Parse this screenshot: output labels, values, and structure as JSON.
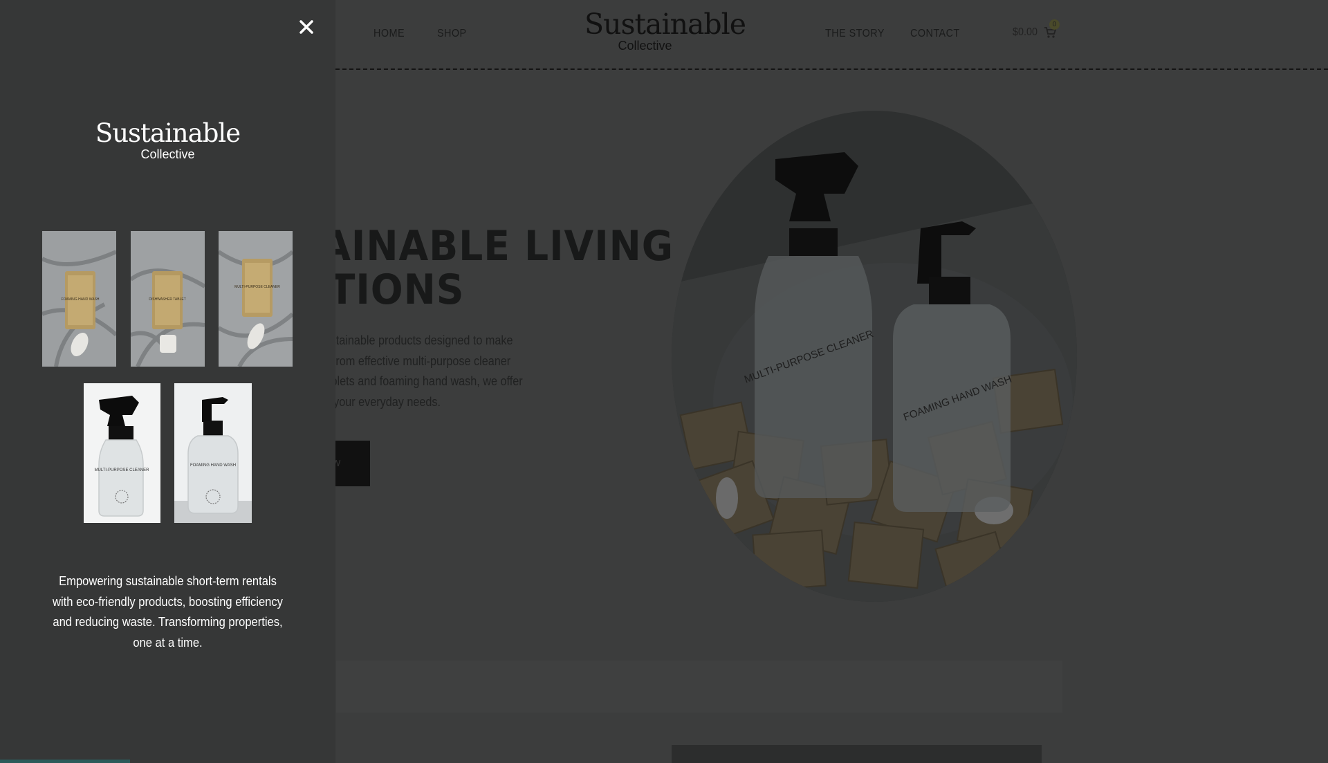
{
  "header": {
    "nav_left": [
      "HOME",
      "SHOP"
    ],
    "brand_title": "Sustainable",
    "brand_subtitle": "Collective",
    "nav_right": [
      "THE STORY",
      "CONTACT"
    ],
    "cart_total": "$0.00",
    "cart_count": "0"
  },
  "hero": {
    "title_line1": "TAINABLE LIVING",
    "title_line2": "UTIONS",
    "text_lines": [
      "ge of sustainable products designed to make",
      "riendly. From effective multi-purpose cleaner",
      "asher tablets and foaming hand wash, we offer",
      "tions for your everyday needs."
    ],
    "button_label": "W",
    "image_labels": [
      "MULTI-PURPOSE CLEANER",
      "FOAMING HAND WASH"
    ]
  },
  "panel": {
    "brand_title": "Sustainable",
    "brand_subtitle": "Collective",
    "thumbnail_labels": [
      "FOAMING HAND WASH",
      "DISHWASHER TABLET",
      "MULTI-PURPOSE CLEANER",
      "MULTI-PURPOSE CLEANER",
      "FOAMING HAND WASH"
    ],
    "description": "Empowering sustainable short-term rentals with eco-friendly products, boosting efficiency and reducing waste. Transforming properties, one at a time."
  },
  "icons": {
    "close": "close-icon",
    "cart": "cart-icon"
  },
  "colors": {
    "overlay": "#363737",
    "page": "#3c3d3d",
    "text_light": "#ffffff"
  }
}
